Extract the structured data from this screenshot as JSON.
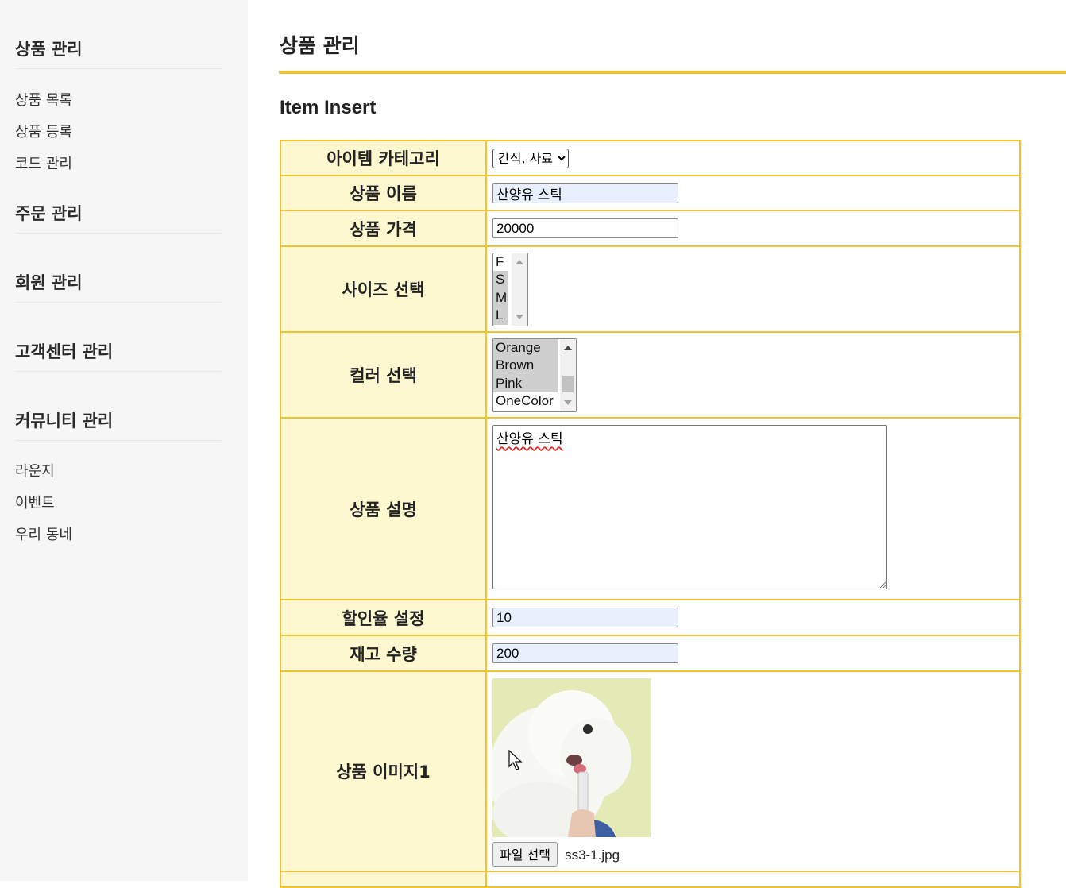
{
  "sidebar": {
    "sections": [
      {
        "title": "상품 관리",
        "links": [
          "상품 목록",
          "상품 등록",
          "코드 관리"
        ]
      },
      {
        "title": "주문 관리",
        "links": []
      },
      {
        "title": "회원 관리",
        "links": []
      },
      {
        "title": "고객센터 관리",
        "links": []
      },
      {
        "title": "커뮤니티 관리",
        "links": [
          "라운지",
          "이벤트",
          "우리 동네"
        ]
      }
    ]
  },
  "main": {
    "page_title": "상품 관리",
    "sub_title": "Item Insert"
  },
  "form": {
    "category": {
      "label": "아이템 카테고리",
      "value": "간식, 사료"
    },
    "name": {
      "label": "상품 이름",
      "value": "산양유 스틱"
    },
    "price": {
      "label": "상품 가격",
      "value": "20000"
    },
    "size": {
      "label": "사이즈 선택",
      "options": [
        "F",
        "S",
        "M",
        "L"
      ],
      "selected": [
        "S",
        "M",
        "L"
      ]
    },
    "color": {
      "label": "컬러 선택",
      "options": [
        "Orange",
        "Brown",
        "Pink",
        "OneColor"
      ],
      "selected": [
        "Orange",
        "Brown",
        "Pink"
      ]
    },
    "description": {
      "label": "상품 설명",
      "value": "산양유 스틱"
    },
    "discount": {
      "label": "할인율 설정",
      "value": "10"
    },
    "stock": {
      "label": "재고 수량",
      "value": "200"
    },
    "image1": {
      "label": "상품 이미지1",
      "button_label": "파일 선택",
      "file_name": "ss3-1.jpg"
    }
  },
  "colors": {
    "accent": "#f2c230",
    "label_bg": "#fdf8cf",
    "sidebar_bg": "#f5f6f5"
  }
}
